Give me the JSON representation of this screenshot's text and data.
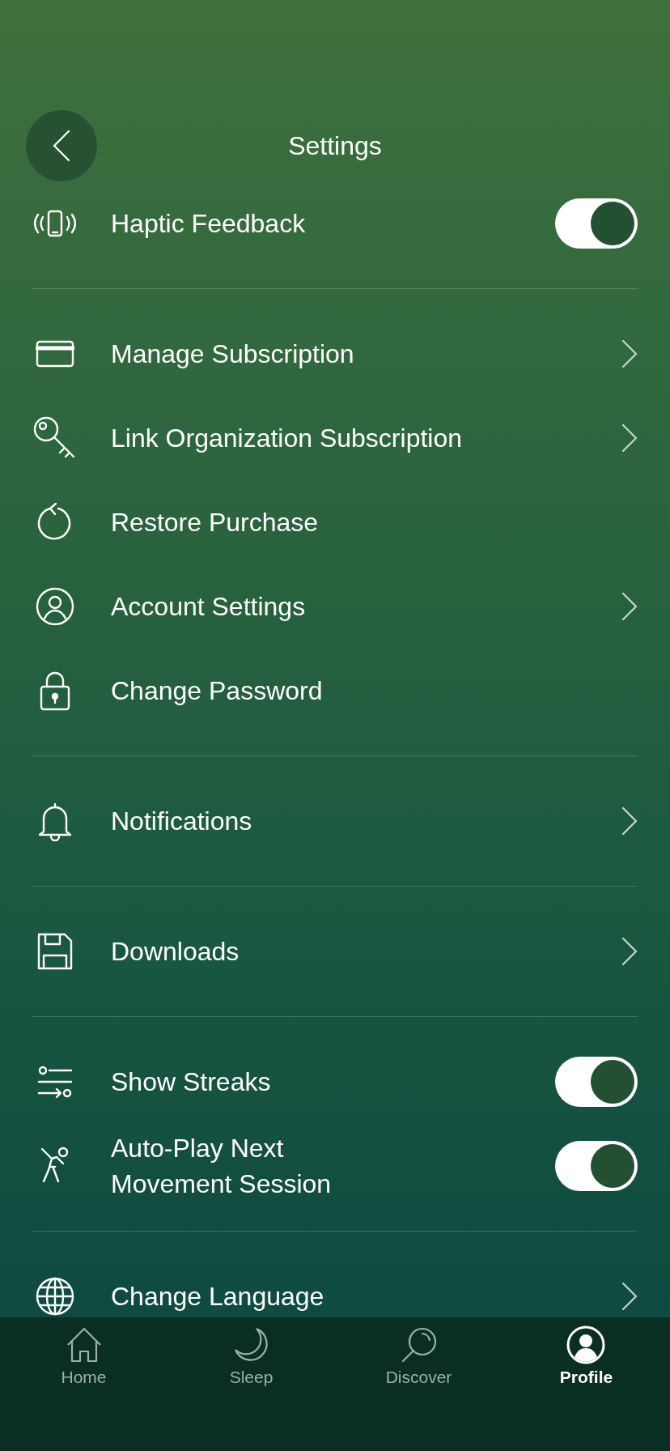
{
  "header": {
    "title": "Settings"
  },
  "sections": [
    {
      "items": [
        {
          "kind": "toggle",
          "label": "Haptic Feedback",
          "on": true
        }
      ]
    },
    {
      "items": [
        {
          "kind": "link",
          "label": "Manage Subscription"
        },
        {
          "kind": "link",
          "label": "Link Organization Subscription"
        },
        {
          "kind": "plain",
          "label": "Restore Purchase"
        },
        {
          "kind": "link",
          "label": "Account Settings"
        },
        {
          "kind": "plain",
          "label": "Change Password"
        }
      ]
    },
    {
      "items": [
        {
          "kind": "link",
          "label": "Notifications"
        }
      ]
    },
    {
      "items": [
        {
          "kind": "link",
          "label": "Downloads"
        }
      ]
    },
    {
      "items": [
        {
          "kind": "toggle",
          "label": "Show Streaks",
          "on": true
        },
        {
          "kind": "toggle",
          "label": "Auto-Play Next\nMovement Session",
          "on": true
        }
      ]
    },
    {
      "items": [
        {
          "kind": "link",
          "label": "Change Language"
        }
      ]
    }
  ],
  "tabs": [
    {
      "label": "Home",
      "selected": false
    },
    {
      "label": "Sleep",
      "selected": false
    },
    {
      "label": "Discover",
      "selected": false
    },
    {
      "label": "Profile",
      "selected": true
    }
  ]
}
